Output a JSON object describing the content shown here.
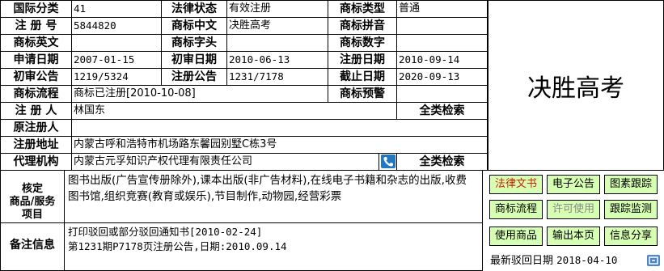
{
  "row1": {
    "intl_class_label": "国际分类",
    "intl_class_value": "41",
    "legal_status_label": "法律状态",
    "legal_status_value": "有效注册",
    "tm_type_label": "商标类型",
    "tm_type_value": "普通"
  },
  "row2": {
    "reg_no_label": "注 册 号",
    "reg_no_value": "5844820",
    "tm_cn_label": "商标中文",
    "tm_cn_value": "决胜高考",
    "tm_pinyin_label": "商标拼音",
    "tm_pinyin_value": ""
  },
  "row3": {
    "tm_en_label": "商标英文",
    "tm_en_value": "",
    "tm_initial_label": "商标字头",
    "tm_initial_value": "",
    "tm_digit_label": "商标数字",
    "tm_digit_value": ""
  },
  "row4": {
    "app_date_label": "申请日期",
    "app_date_value": "2007-01-15",
    "prelim_date_label": "初审日期",
    "prelim_date_value": "2010-06-13",
    "reg_date_label": "注册日期",
    "reg_date_value": "2010-09-14"
  },
  "row5": {
    "prelim_notice_label": "初审公告",
    "prelim_notice_value": "1219/5324",
    "reg_notice_label": "注册公告",
    "reg_notice_value": "1231/7178",
    "expiry_label": "截止日期",
    "expiry_value": "2020-09-13"
  },
  "row6": {
    "process_label": "商标流程",
    "process_value": "商标已注册[2010-10-08]",
    "warning_label": "商标预警",
    "warning_value": ""
  },
  "row7": {
    "registrant_label": "注 册 人",
    "registrant_value": "林国东",
    "search_label": "全类检索"
  },
  "row8": {
    "orig_registrant_label": "原注册人",
    "orig_registrant_value": ""
  },
  "row9": {
    "address_label": "注册地址",
    "address_value": "内蒙古呼和浩特市机场路东馨园别墅C栋3号"
  },
  "row10": {
    "agent_label": "代理机构",
    "agent_value": "内蒙古元孚知识产权代理有限责任公司",
    "search_label": "全类检索"
  },
  "brand_display": "决胜高考",
  "goods": {
    "label_line1": "核定",
    "label_line2": "商品/服务",
    "label_line3": "项目",
    "value": "图书出版(广告宣传册除外),课本出版(非广告材料),在线电子书籍和杂志的出版,收费图书馆,组织竞赛(教育或娱乐),节目制作,动物园,经营彩票"
  },
  "notes": {
    "label": "备注信息",
    "line1": "打印驳回或部分驳回通知书[2010-02-24]",
    "line2": "第1231期P7178页注册公告,日期:2010.09.14"
  },
  "buttons": [
    {
      "label": "法律文书",
      "color": "#cc2200"
    },
    {
      "label": "电子公告",
      "color": "#000000"
    },
    {
      "label": "图素跟踪",
      "color": "#000000"
    },
    {
      "label": "商标流程",
      "color": "#000000"
    },
    {
      "label": "许可使用",
      "color": "#888888"
    },
    {
      "label": "跟踪监测",
      "color": "#000000"
    },
    {
      "label": "使用商品",
      "color": "#000000"
    },
    {
      "label": "输出本页",
      "color": "#000000"
    },
    {
      "label": "信息分享",
      "color": "#000000"
    }
  ],
  "latest_rejection": {
    "label": "最新驳回日期",
    "value": "2018-04-10"
  },
  "colors": {
    "button_bg": "#d6ffb4",
    "icon_blue": "#1f78c1"
  }
}
